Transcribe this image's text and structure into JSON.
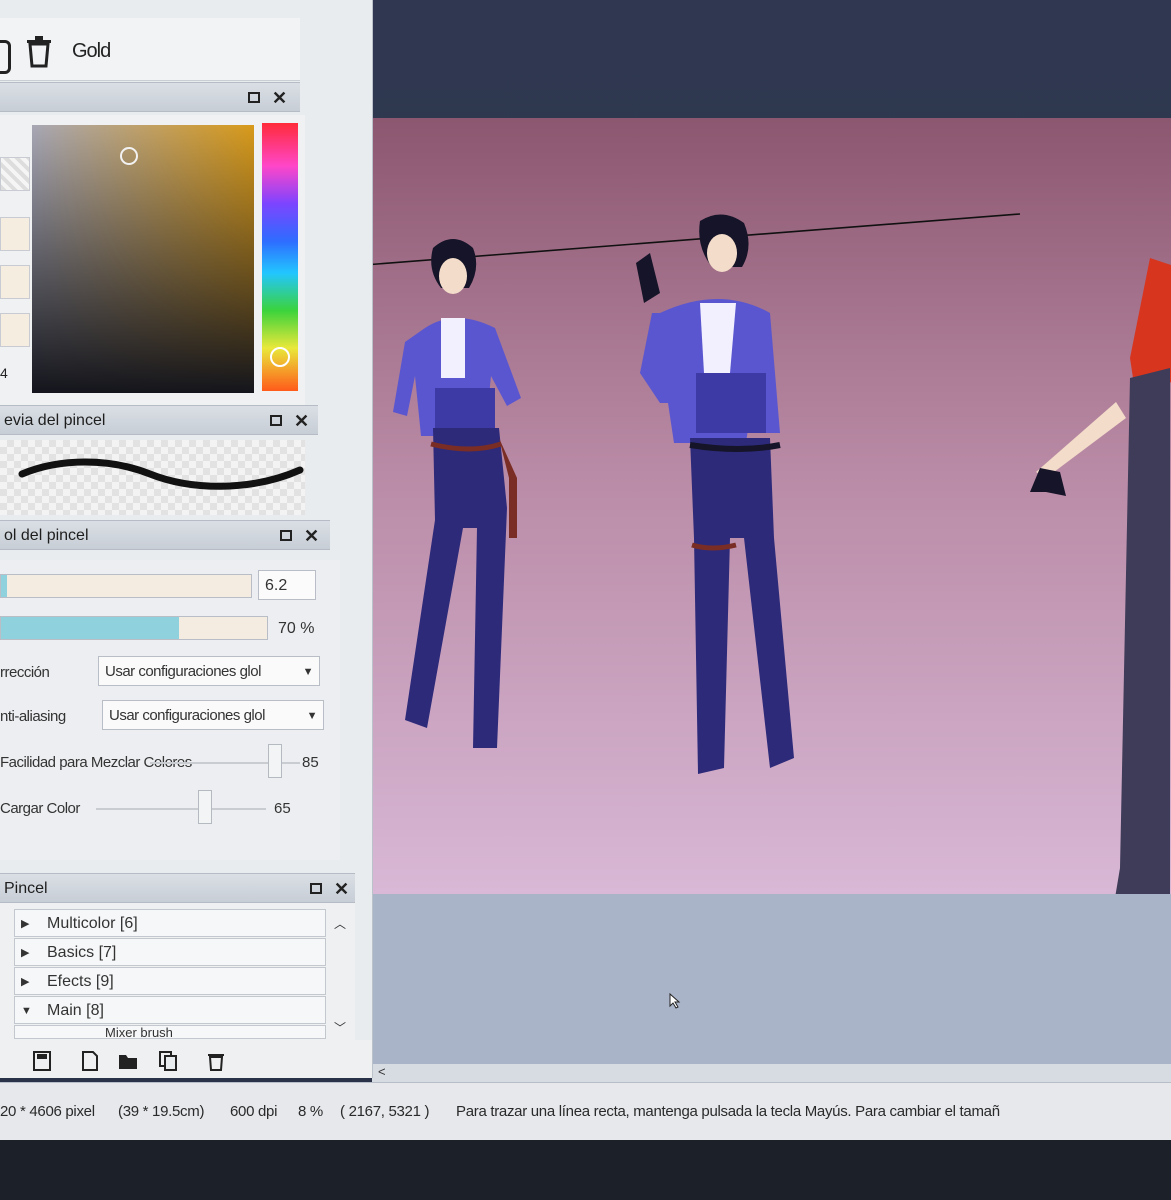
{
  "toolbar": {
    "label": "Gold"
  },
  "color_panel": {
    "swatch_value": "4"
  },
  "brush_preview": {
    "title": "evia del pincel"
  },
  "brush_control": {
    "title": "ol del pincel",
    "size_value": "6.2",
    "density_value": "70 %",
    "correction_label": "rrección",
    "correction_value": "Usar configuraciones glol",
    "antialias_label": "nti-aliasing",
    "antialias_value": "Usar configuraciones glol",
    "blend_label": "Facilidad para Mezclar Colores",
    "blend_value": "85",
    "load_label": "Cargar Color",
    "load_value": "65"
  },
  "brush_list": {
    "title": "Pincel",
    "groups": [
      {
        "label": "Multicolor [6]",
        "expanded": false
      },
      {
        "label": "Basics [7]",
        "expanded": false
      },
      {
        "label": "Efects [9]",
        "expanded": false
      },
      {
        "label": "Main [8]",
        "expanded": true
      }
    ],
    "partial_item": "Mixer brush"
  },
  "status_bar": {
    "size_px": "20 * 4606 pixel",
    "size_cm": "(39 * 19.5cm)",
    "dpi": "600 dpi",
    "zoom": "8 %",
    "coords": "( 2167, 5321 )",
    "hint": "Para trazar una línea recta, mantenga pulsada la tecla Mayús. Para cambiar el tamañ"
  },
  "colors": {
    "accent_slider": "#8fd2de",
    "canvas_top": "#8c5770",
    "canvas_bottom": "#d8b8d6",
    "picked_color": "#d89a1a"
  }
}
